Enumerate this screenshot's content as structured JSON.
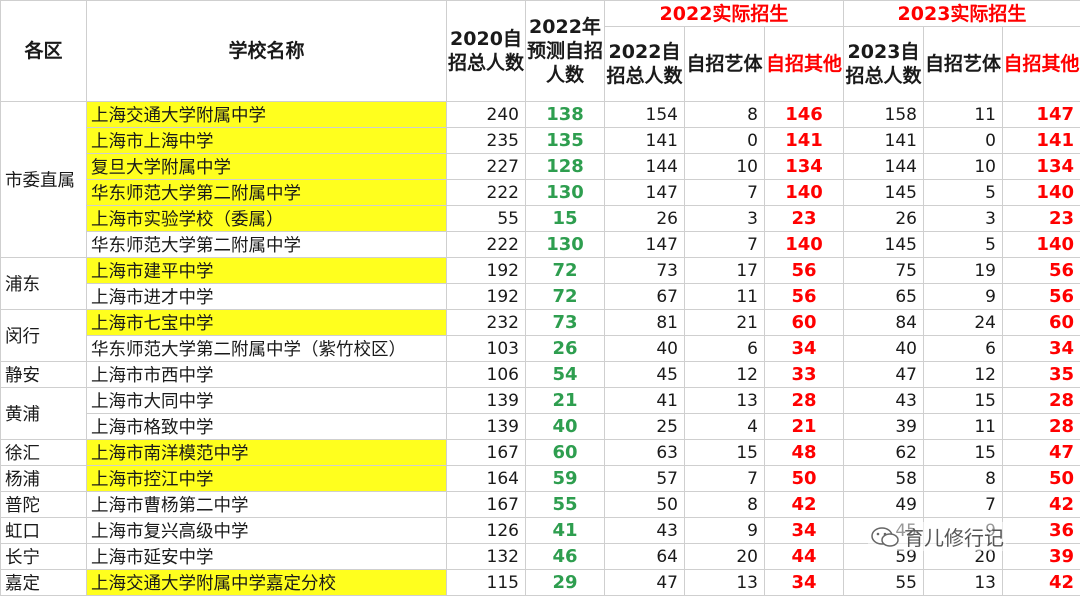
{
  "headers": {
    "district": "各区",
    "school": "学校名称",
    "y2020_total": "2020自招总人数",
    "y2022_pred": "2022年预测自招人数",
    "group_2022": "2022实际招生",
    "group_2023": "2023实际招生",
    "total_2022": "2022自招总人数",
    "art_2022": "自招艺体",
    "other_2022": "自招其他",
    "total_2023": "2023自招总人数",
    "art_2023": "自招艺体",
    "other_2023": "自招其他"
  },
  "districts": [
    "市委直属",
    "浦东",
    "闵行",
    "静安",
    "黄浦",
    "徐汇",
    "杨浦",
    "普陀",
    "虹口",
    "长宁",
    "嘉定"
  ],
  "rows": [
    {
      "school": "上海交通大学附属中学",
      "v2020": "240",
      "pred": "138",
      "t22": "154",
      "a22": "8",
      "o22": "146",
      "t23": "158",
      "a23": "11",
      "o23": "147"
    },
    {
      "school": "上海市上海中学",
      "v2020": "235",
      "pred": "135",
      "t22": "141",
      "a22": "0",
      "o22": "141",
      "t23": "141",
      "a23": "0",
      "o23": "141"
    },
    {
      "school": "复旦大学附属中学",
      "v2020": "227",
      "pred": "128",
      "t22": "144",
      "a22": "10",
      "o22": "134",
      "t23": "144",
      "a23": "10",
      "o23": "134"
    },
    {
      "school": "华东师范大学第二附属中学",
      "v2020": "222",
      "pred": "130",
      "t22": "147",
      "a22": "7",
      "o22": "140",
      "t23": "145",
      "a23": "5",
      "o23": "140"
    },
    {
      "school": "上海市实验学校（委属）",
      "v2020": "55",
      "pred": "15",
      "t22": "26",
      "a22": "3",
      "o22": "23",
      "t23": "26",
      "a23": "3",
      "o23": "23"
    },
    {
      "school": "华东师范大学第二附属中学",
      "v2020": "222",
      "pred": "130",
      "t22": "147",
      "a22": "7",
      "o22": "140",
      "t23": "145",
      "a23": "5",
      "o23": "140"
    },
    {
      "school": "上海市建平中学",
      "v2020": "192",
      "pred": "72",
      "t22": "73",
      "a22": "17",
      "o22": "56",
      "t23": "75",
      "a23": "19",
      "o23": "56"
    },
    {
      "school": "上海市进才中学",
      "v2020": "192",
      "pred": "72",
      "t22": "67",
      "a22": "11",
      "o22": "56",
      "t23": "65",
      "a23": "9",
      "o23": "56"
    },
    {
      "school": "上海市七宝中学",
      "v2020": "232",
      "pred": "73",
      "t22": "81",
      "a22": "21",
      "o22": "60",
      "t23": "84",
      "a23": "24",
      "o23": "60"
    },
    {
      "school": "华东师范大学第二附属中学（紫竹校区）",
      "v2020": "103",
      "pred": "26",
      "t22": "40",
      "a22": "6",
      "o22": "34",
      "t23": "40",
      "a23": "6",
      "o23": "34"
    },
    {
      "school": "上海市市西中学",
      "v2020": "106",
      "pred": "54",
      "t22": "45",
      "a22": "12",
      "o22": "33",
      "t23": "47",
      "a23": "12",
      "o23": "35"
    },
    {
      "school": "上海市大同中学",
      "v2020": "139",
      "pred": "21",
      "t22": "41",
      "a22": "13",
      "o22": "28",
      "t23": "43",
      "a23": "15",
      "o23": "28"
    },
    {
      "school": "上海市格致中学",
      "v2020": "139",
      "pred": "40",
      "t22": "25",
      "a22": "4",
      "o22": "21",
      "t23": "39",
      "a23": "11",
      "o23": "28"
    },
    {
      "school": "上海市南洋模范中学",
      "v2020": "167",
      "pred": "60",
      "t22": "63",
      "a22": "15",
      "o22": "48",
      "t23": "62",
      "a23": "15",
      "o23": "47"
    },
    {
      "school": "上海市控江中学",
      "v2020": "164",
      "pred": "59",
      "t22": "57",
      "a22": "7",
      "o22": "50",
      "t23": "58",
      "a23": "8",
      "o23": "50"
    },
    {
      "school": "上海市曹杨第二中学",
      "v2020": "167",
      "pred": "55",
      "t22": "50",
      "a22": "8",
      "o22": "42",
      "t23": "49",
      "a23": "7",
      "o23": "42"
    },
    {
      "school": "上海市复兴高级中学",
      "v2020": "126",
      "pred": "41",
      "t22": "43",
      "a22": "9",
      "o22": "34",
      "t23": "45",
      "a23": "9",
      "o23": "36"
    },
    {
      "school": "上海市延安中学",
      "v2020": "132",
      "pred": "46",
      "t22": "64",
      "a22": "20",
      "o22": "44",
      "t23": "59",
      "a23": "20",
      "o23": "39"
    },
    {
      "school": "上海交通大学附属中学嘉定分校",
      "v2020": "115",
      "pred": "29",
      "t22": "47",
      "a22": "13",
      "o22": "34",
      "t23": "55",
      "a23": "13",
      "o23": "42"
    }
  ],
  "watermark": "育儿修行记",
  "colors": {
    "highlight": "#ffff1e",
    "green": "#2e9e4f",
    "red": "#ff0000"
  }
}
